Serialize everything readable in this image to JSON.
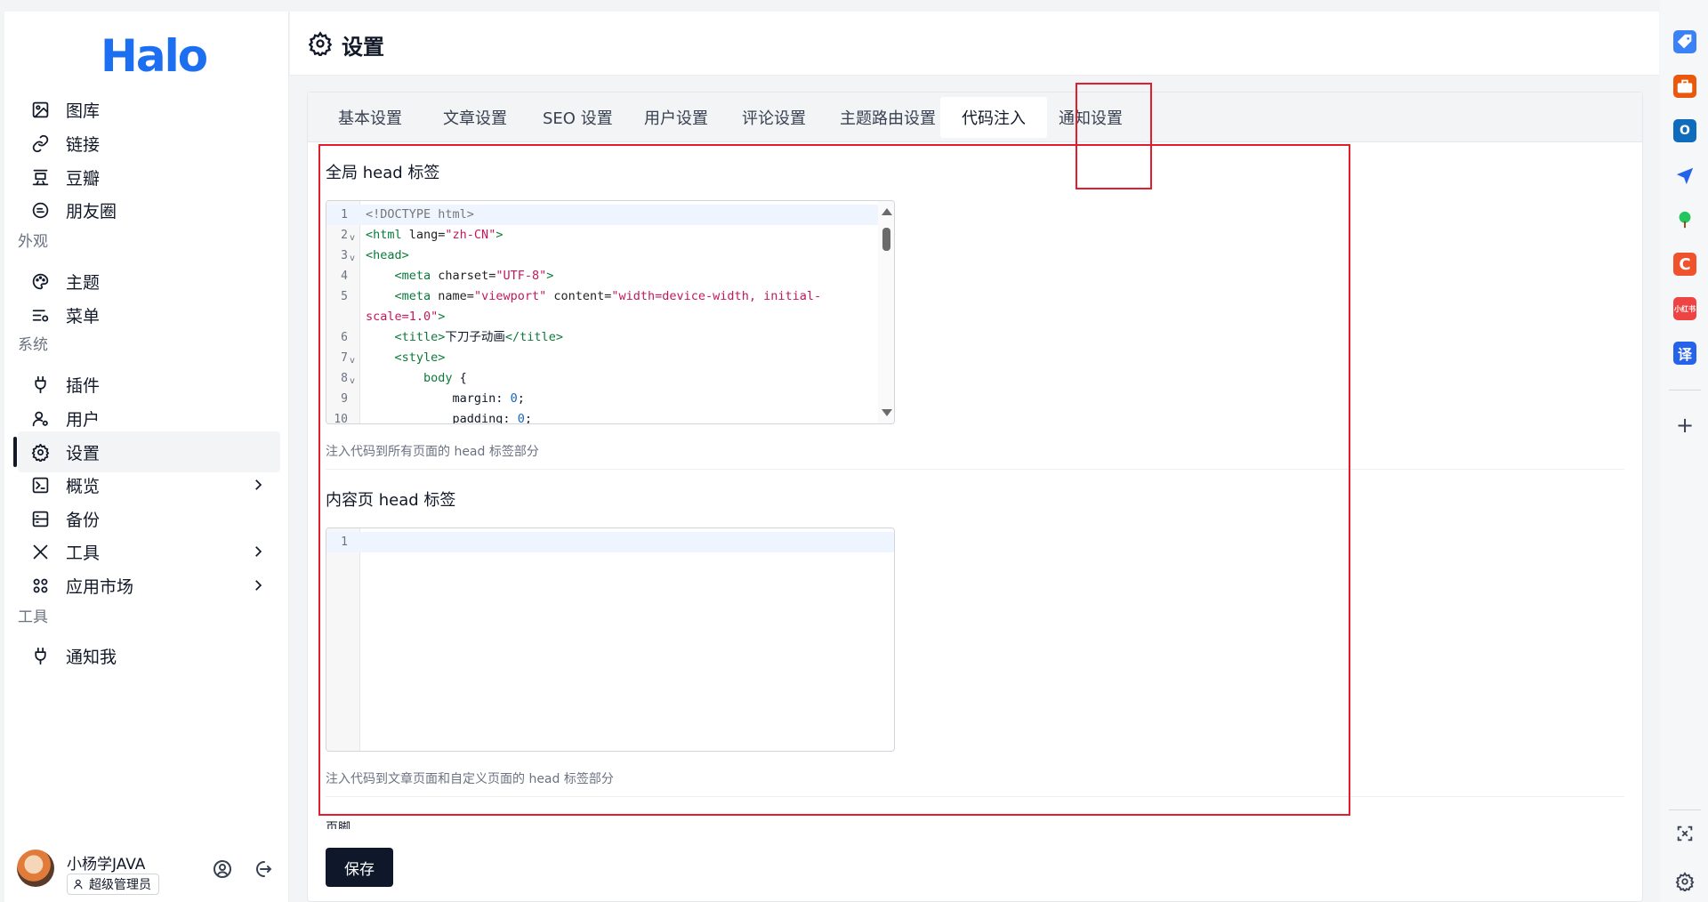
{
  "app": {
    "logo": "Halo"
  },
  "sidebar": {
    "items_top": [
      {
        "label": "图库",
        "icon": "image-icon"
      },
      {
        "label": "链接",
        "icon": "link-icon"
      },
      {
        "label": "豆瓣",
        "icon": "douban-icon"
      },
      {
        "label": "朋友圈",
        "icon": "moments-icon"
      }
    ],
    "group_appearance": "外观",
    "items_appearance": [
      {
        "label": "主题",
        "icon": "palette-icon"
      },
      {
        "label": "菜单",
        "icon": "menu-settings-icon"
      }
    ],
    "group_system": "系统",
    "items_system": [
      {
        "label": "插件",
        "icon": "plug-icon"
      },
      {
        "label": "用户",
        "icon": "user-icon"
      },
      {
        "label": "设置",
        "icon": "gear-icon",
        "active": true
      },
      {
        "label": "概览",
        "icon": "terminal-icon"
      },
      {
        "label": "备份",
        "icon": "backup-icon"
      },
      {
        "label": "工具",
        "icon": "tools-icon"
      },
      {
        "label": "应用市场",
        "icon": "apps-icon"
      }
    ],
    "group_tools": "工具",
    "items_tools": [
      {
        "label": "通知我",
        "icon": "plug-icon"
      }
    ],
    "user": {
      "name": "小杨学JAVA",
      "role": "超级管理员"
    }
  },
  "header": {
    "title": "设置"
  },
  "tabs": [
    "基本设置",
    "文章设置",
    "SEO 设置",
    "用户设置",
    "评论设置",
    "主题路由设置",
    "代码注入",
    "通知设置"
  ],
  "active_tab": "代码注入",
  "sections": {
    "global_head": {
      "title": "全局 head 标签",
      "hint": "注入代码到所有页面的 head 标签部分",
      "line_numbers": [
        "1",
        "2",
        "3",
        "4",
        "5",
        "",
        "6",
        "7",
        "8",
        "9",
        "10"
      ]
    },
    "content_head": {
      "title": "内容页 head 标签",
      "hint": "注入代码到文章页面和自定义页面的 head 标签部分",
      "line_numbers": [
        "1"
      ]
    },
    "cut_text": "页脚"
  },
  "save_label": "保存",
  "colors": {
    "accent": "#1d6ff2",
    "annotation": "#e11d2e",
    "button": "#0f172a"
  }
}
